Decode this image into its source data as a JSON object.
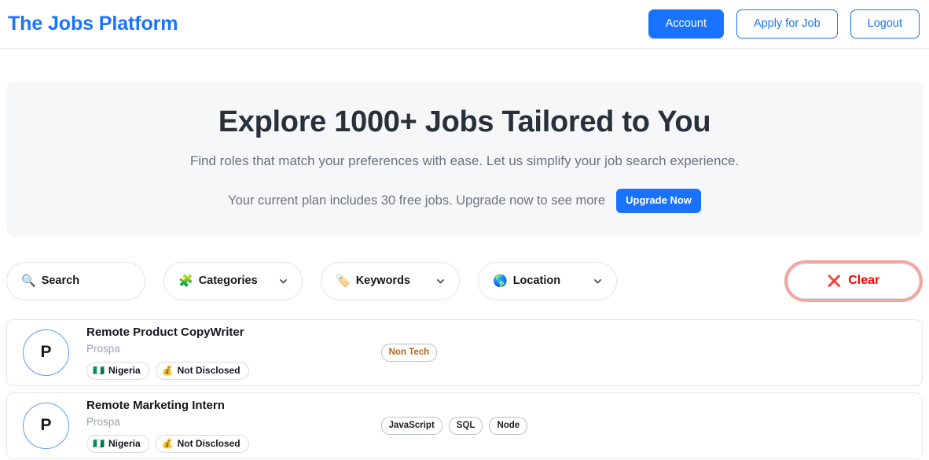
{
  "header": {
    "brand": "The Jobs Platform",
    "actions": [
      {
        "label": "Account",
        "style": "primary"
      },
      {
        "label": "Apply for Job",
        "style": "outline"
      },
      {
        "label": "Logout",
        "style": "outline"
      }
    ]
  },
  "hero": {
    "title": "Explore 1000+ Jobs Tailored to You",
    "subtitle": "Find roles that match your preferences with ease. Let us simplify your job search experience.",
    "plan_text": "Your current plan includes 30 free jobs. Upgrade now to see more",
    "upgrade_button": "Upgrade Now"
  },
  "filters": {
    "search": {
      "label": "Search",
      "icon": "search-icon",
      "glyph": "🔍"
    },
    "categories": {
      "label": "Categories",
      "icon": "puzzle-icon",
      "glyph": "🧩"
    },
    "keywords": {
      "label": "Keywords",
      "icon": "tag-icon",
      "glyph": "🏷️"
    },
    "location": {
      "label": "Location",
      "icon": "globe-icon",
      "glyph": "🌎"
    },
    "clear": {
      "label": "Clear",
      "icon": "close-x-icon",
      "glyph": "❌",
      "color": "#ff0000",
      "ring_color": "#f2a6a0"
    }
  },
  "jobs": [
    {
      "avatar_initial": "P",
      "title": "Remote Product CopyWriter",
      "company": "Prospa",
      "country": "Nigeria",
      "country_flag": "🇳🇬",
      "salary": "Not Disclosed",
      "salary_icon": "💰",
      "tags": [
        {
          "label": "Non Tech",
          "kind": "nontech"
        }
      ]
    },
    {
      "avatar_initial": "P",
      "title": "Remote Marketing Intern",
      "company": "Prospa",
      "country": "Nigeria",
      "country_flag": "🇳🇬",
      "salary": "Not Disclosed",
      "salary_icon": "💰",
      "tags": [
        {
          "label": "JavaScript",
          "kind": "tech"
        },
        {
          "label": "SQL",
          "kind": "tech"
        },
        {
          "label": "Node",
          "kind": "tech"
        }
      ]
    }
  ],
  "colors": {
    "brand_blue": "#1a73ff",
    "hero_bg": "#f6f7f9",
    "clear_red": "#ff0000",
    "nontech_tag": "#b5651d"
  }
}
